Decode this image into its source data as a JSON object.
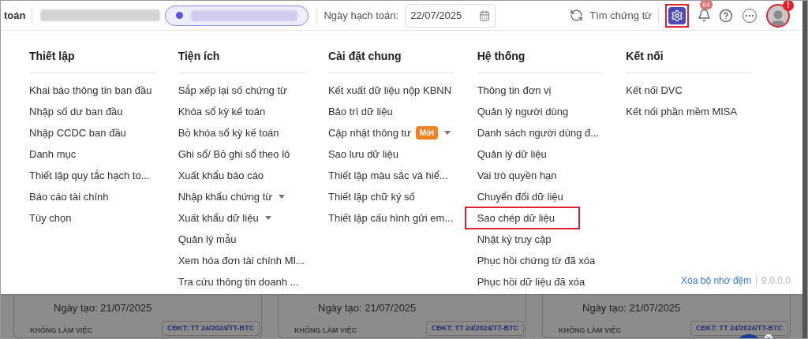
{
  "header": {
    "title_fragment": "toán",
    "posting_date_label": "Ngày hạch toán:",
    "posting_date": "22/07/2025",
    "search_voucher": "Tìm chứng từ",
    "settings_highlighted": true,
    "notification_count": "84",
    "avatar_alert": "!"
  },
  "menu": {
    "columns": [
      {
        "title": "Thiết lập",
        "items": [
          {
            "label": "Khai báo thông tin ban đầu",
            "has_submenu": false,
            "highlighted": false
          },
          {
            "label": "Nhập số dư ban đầu",
            "has_submenu": false,
            "highlighted": false
          },
          {
            "label": "Nhập CCDC ban đầu",
            "has_submenu": false,
            "highlighted": false
          },
          {
            "label": "Danh mục",
            "has_submenu": false,
            "highlighted": false
          },
          {
            "label": "Thiết lập quy tắc hạch to...",
            "has_submenu": false,
            "highlighted": false
          },
          {
            "label": "Báo cáo tài chính",
            "has_submenu": false,
            "highlighted": false
          },
          {
            "label": "Tùy chọn",
            "has_submenu": false,
            "highlighted": false
          }
        ]
      },
      {
        "title": "Tiện ích",
        "items": [
          {
            "label": "Sắp xếp lại số chứng từ",
            "has_submenu": false,
            "highlighted": false
          },
          {
            "label": "Khóa sổ kỳ kế toán",
            "has_submenu": false,
            "highlighted": false
          },
          {
            "label": "Bỏ khóa sổ kỳ kế toán",
            "has_submenu": false,
            "highlighted": false
          },
          {
            "label": "Ghi sổ/ Bỏ ghi sổ theo lô",
            "has_submenu": false,
            "highlighted": false
          },
          {
            "label": "Xuất khẩu báo cáo",
            "has_submenu": false,
            "highlighted": false
          },
          {
            "label": "Nhập khẩu chứng từ",
            "has_submenu": true,
            "highlighted": false
          },
          {
            "label": "Xuất khẩu dữ liệu",
            "has_submenu": true,
            "highlighted": false
          },
          {
            "label": "Quản lý mẫu",
            "has_submenu": false,
            "highlighted": false
          },
          {
            "label": "Xem hóa đơn tài chính MI...",
            "has_submenu": false,
            "highlighted": false
          },
          {
            "label": "Tra cứu thông tin doanh ...",
            "has_submenu": false,
            "highlighted": false
          }
        ]
      },
      {
        "title": "Cài đặt chung",
        "items": [
          {
            "label": "Kết xuất dữ liệu nộp KBNN",
            "has_submenu": false,
            "highlighted": false
          },
          {
            "label": "Bảo trì dữ liệu",
            "has_submenu": false,
            "highlighted": false
          },
          {
            "label": "Cập nhật thông tư",
            "badge": "Mới",
            "has_submenu": true,
            "highlighted": false
          },
          {
            "label": "Sao lưu dữ liệu",
            "has_submenu": false,
            "highlighted": false
          },
          {
            "label": "Thiết lập màu sắc và hiể...",
            "has_submenu": false,
            "highlighted": false
          },
          {
            "label": "Thiết lập chữ ký số",
            "has_submenu": false,
            "highlighted": false
          },
          {
            "label": "Thiết lập cấu hình gửi em...",
            "has_submenu": false,
            "highlighted": false
          }
        ]
      },
      {
        "title": "Hệ thống",
        "items": [
          {
            "label": "Thông tin đơn vị",
            "has_submenu": false,
            "highlighted": false
          },
          {
            "label": "Quản lý người dùng",
            "has_submenu": false,
            "highlighted": false
          },
          {
            "label": "Danh sách người dùng đ...",
            "has_submenu": false,
            "highlighted": false
          },
          {
            "label": "Quản lý dữ liệu",
            "has_submenu": false,
            "highlighted": false
          },
          {
            "label": "Vai trò quyền hạn",
            "has_submenu": false,
            "highlighted": false
          },
          {
            "label": "Chuyển đổi dữ liệu",
            "has_submenu": false,
            "highlighted": false
          },
          {
            "label": "Sao chép dữ liệu",
            "has_submenu": false,
            "highlighted": true
          },
          {
            "label": "Nhật ký truy cập",
            "has_submenu": false,
            "highlighted": false
          },
          {
            "label": "Phục hồi chứng từ đã xóa",
            "has_submenu": false,
            "highlighted": false
          },
          {
            "label": "Phục hồi dữ liệu đã xóa",
            "has_submenu": false,
            "highlighted": false
          }
        ]
      },
      {
        "title": "Kết nối",
        "items": [
          {
            "label": "Kết nối DVC",
            "has_submenu": false,
            "highlighted": false
          },
          {
            "label": "Kết nối phần mềm MISA",
            "has_submenu": false,
            "highlighted": false
          }
        ]
      }
    ],
    "clear_cache": "Xóa bộ nhớ đệm",
    "version": "9.0.0.0"
  },
  "cards": [
    {
      "created": "Ngày tạo: 21/07/2025",
      "status": "KHÔNG LÀM VIỆC",
      "regime": "CĐKT: TT 24/2024/TT-BTC"
    },
    {
      "created": "Ngày tạo: 21/07/2025",
      "status": "KHÔNG LÀM VIỆC",
      "regime": "CĐKT: TT 24/2024/TT-BTC"
    },
    {
      "created": "Ngày tạo: 21/07/2025",
      "status": "KHÔNG LÀM VIỆC",
      "regime": "CĐKT: TT 24/2024/TT-BTC"
    }
  ]
}
